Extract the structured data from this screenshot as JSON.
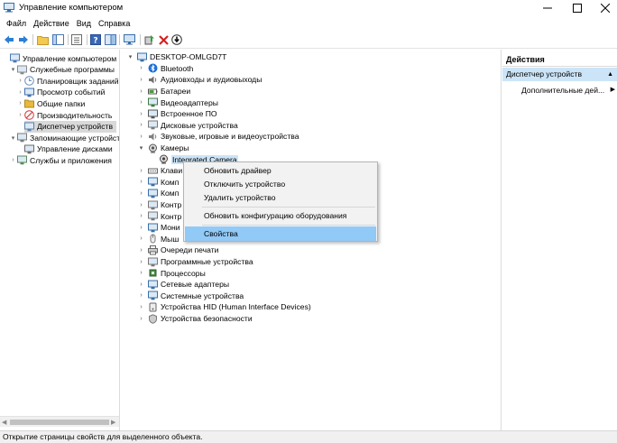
{
  "window": {
    "title": "Управление компьютером"
  },
  "menu": [
    "Файл",
    "Действие",
    "Вид",
    "Справка"
  ],
  "left_tree": [
    {
      "label": "Управление компьютером (л",
      "indent": 0,
      "expander": "",
      "icon": "computer-management-icon"
    },
    {
      "label": "Служебные программы",
      "indent": 1,
      "expander": "▾",
      "icon": "tools-icon"
    },
    {
      "label": "Планировщик заданий",
      "indent": 2,
      "expander": "›",
      "icon": "clock-icon"
    },
    {
      "label": "Просмотр событий",
      "indent": 2,
      "expander": "›",
      "icon": "event-viewer-icon"
    },
    {
      "label": "Общие папки",
      "indent": 2,
      "expander": "›",
      "icon": "shared-folder-icon"
    },
    {
      "label": "Производительность",
      "indent": 2,
      "expander": "›",
      "icon": "performance-icon"
    },
    {
      "label": "Диспетчер устройств",
      "indent": 2,
      "expander": "",
      "icon": "device-manager-icon",
      "selected": true
    },
    {
      "label": "Запоминающие устройст",
      "indent": 1,
      "expander": "▾",
      "icon": "storage-icon"
    },
    {
      "label": "Управление дисками",
      "indent": 2,
      "expander": "",
      "icon": "disk-management-icon"
    },
    {
      "label": "Службы и приложения",
      "indent": 1,
      "expander": "›",
      "icon": "services-icon"
    }
  ],
  "device_tree": [
    {
      "label": "DESKTOP-OMLGD7T",
      "level": 0,
      "expander": "▾",
      "icon": "computer-icon"
    },
    {
      "label": "Bluetooth",
      "level": 1,
      "expander": "›",
      "icon": "bluetooth-icon"
    },
    {
      "label": "Аудиовходы и аудиовыходы",
      "level": 1,
      "expander": "›",
      "icon": "audio-icon"
    },
    {
      "label": "Батареи",
      "level": 1,
      "expander": "›",
      "icon": "battery-icon"
    },
    {
      "label": "Видеоадаптеры",
      "level": 1,
      "expander": "›",
      "icon": "display-adapter-icon"
    },
    {
      "label": "Встроенное ПО",
      "level": 1,
      "expander": "›",
      "icon": "firmware-icon"
    },
    {
      "label": "Дисковые устройства",
      "level": 1,
      "expander": "›",
      "icon": "disk-drive-icon"
    },
    {
      "label": "Звуковые, игровые и видеоустройства",
      "level": 1,
      "expander": "›",
      "icon": "sound-icon"
    },
    {
      "label": "Камеры",
      "level": 1,
      "expander": "▾",
      "icon": "camera-icon"
    },
    {
      "label": "Integrated Camera",
      "level": 2,
      "expander": "",
      "icon": "webcam-icon",
      "highlight": true
    },
    {
      "label": "Клави",
      "level": 1,
      "expander": "›",
      "icon": "keyboard-icon"
    },
    {
      "label": "Комп",
      "level": 1,
      "expander": "›",
      "icon": "computer-small-icon"
    },
    {
      "label": "Комп",
      "level": 1,
      "expander": "›",
      "icon": "monitor-small-icon"
    },
    {
      "label": "Контр",
      "level": 1,
      "expander": "›",
      "icon": "controller-icon"
    },
    {
      "label": "Контр",
      "level": 1,
      "expander": "›",
      "icon": "controller2-icon"
    },
    {
      "label": "Мони",
      "level": 1,
      "expander": "›",
      "icon": "monitor-icon"
    },
    {
      "label": "Мыш",
      "level": 1,
      "expander": "›",
      "icon": "mouse-icon"
    },
    {
      "label": "Очереди печати",
      "level": 1,
      "expander": "›",
      "icon": "print-queue-icon"
    },
    {
      "label": "Программные устройства",
      "level": 1,
      "expander": "›",
      "icon": "software-device-icon"
    },
    {
      "label": "Процессоры",
      "level": 1,
      "expander": "›",
      "icon": "processor-icon"
    },
    {
      "label": "Сетевые адаптеры",
      "level": 1,
      "expander": "›",
      "icon": "network-adapter-icon"
    },
    {
      "label": "Системные устройства",
      "level": 1,
      "expander": "›",
      "icon": "system-device-icon"
    },
    {
      "label": "Устройства HID (Human Interface Devices)",
      "level": 1,
      "expander": "›",
      "icon": "hid-icon"
    },
    {
      "label": "Устройства безопасности",
      "level": 1,
      "expander": "›",
      "icon": "security-device-icon"
    }
  ],
  "context_menu": {
    "update_driver": "Обновить драйвер",
    "disable_device": "Отключить устройство",
    "uninstall_device": "Удалить устройство",
    "scan_hardware": "Обновить конфигурацию оборудования",
    "properties": "Свойства"
  },
  "actions": {
    "header": "Действия",
    "device_manager": "Диспетчер устройств",
    "more": "Дополнительные дей..."
  },
  "status": "Открытие страницы свойств для выделенного объекта.",
  "colors": {
    "selection": "#cce4f7",
    "menu_hover": "#91c9f7"
  }
}
